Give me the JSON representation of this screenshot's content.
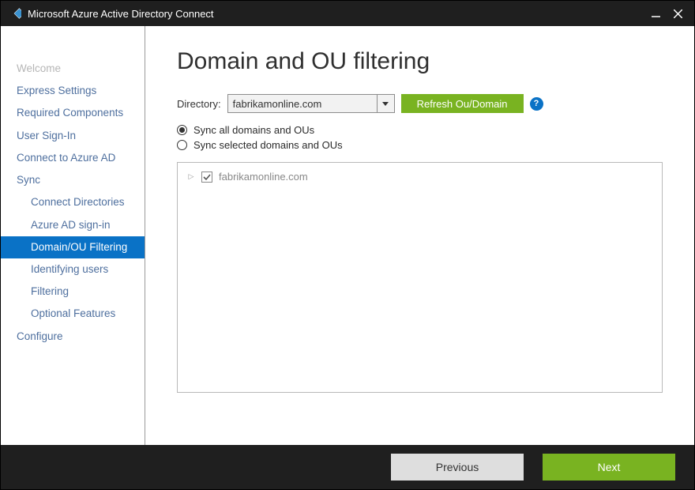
{
  "window": {
    "title": "Microsoft Azure Active Directory Connect"
  },
  "sidebar": {
    "items": [
      {
        "label": "Welcome",
        "kind": "top",
        "disabled": true
      },
      {
        "label": "Express Settings",
        "kind": "top"
      },
      {
        "label": "Required Components",
        "kind": "top"
      },
      {
        "label": "User Sign-In",
        "kind": "top"
      },
      {
        "label": "Connect to Azure AD",
        "kind": "top"
      },
      {
        "label": "Sync",
        "kind": "top"
      },
      {
        "label": "Connect Directories",
        "kind": "sub"
      },
      {
        "label": "Azure AD sign-in",
        "kind": "sub"
      },
      {
        "label": "Domain/OU Filtering",
        "kind": "sub",
        "active": true
      },
      {
        "label": "Identifying users",
        "kind": "sub"
      },
      {
        "label": "Filtering",
        "kind": "sub"
      },
      {
        "label": "Optional Features",
        "kind": "sub"
      },
      {
        "label": "Configure",
        "kind": "top"
      }
    ]
  },
  "page": {
    "title": "Domain and OU filtering",
    "directory_label": "Directory:",
    "directory_value": "fabrikamonline.com",
    "refresh_button": "Refresh Ou/Domain",
    "help_glyph": "?",
    "radios": {
      "all": "Sync all domains and OUs",
      "selected": "Sync selected domains and OUs",
      "checked": "all"
    },
    "tree": {
      "root_label": "fabrikamonline.com",
      "root_checked": true,
      "root_expanded": false
    }
  },
  "footer": {
    "previous": "Previous",
    "next": "Next"
  }
}
